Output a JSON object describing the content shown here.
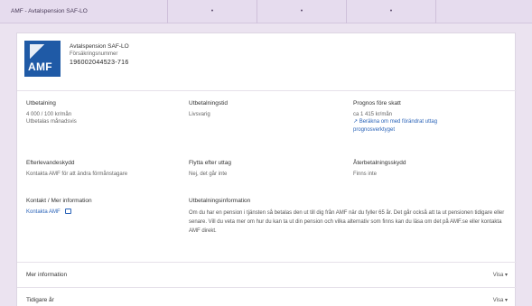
{
  "topbar": {
    "title": "AMF - Avtalspension SAF-LO",
    "tabs": [
      "•",
      "•",
      "•"
    ]
  },
  "company": {
    "logo_text": "AMF",
    "name": "Avtalspension SAF-LO",
    "type": "Försäkringsnummer",
    "orgnr": "196002044523-716"
  },
  "fields": {
    "utbetalning": {
      "label": "Utbetalning",
      "value1": "4 000 / 100 kr/mån",
      "value2": "Utbetalas månadsvis"
    },
    "utbetalningsform": {
      "label": "Utbetalningstid",
      "value": "Livsvarig"
    },
    "prognos": {
      "label": "Prognos före skatt",
      "value": "ca 1 415 kr/mån",
      "link1": "Beräkna om med förändrat uttag",
      "link2": "prognosverktyget"
    },
    "efterlevandeskydd": {
      "label": "Efterlevandeskydd",
      "value": "Kontakta AMF för att ändra förmånstagare"
    },
    "flytta": {
      "label": "Flytta efter uttag",
      "value": "Nej, det går inte"
    },
    "aterbetalning": {
      "label": "Återbetalningsskydd",
      "value": "Finns inte"
    },
    "kontakt": {
      "label": "Kontakt / Mer information",
      "link": "Kontakta AMF"
    },
    "utbetalningsinfo": {
      "label": "Utbetalningsinformation",
      "text": "Om du har en pension i tjänsten så betalas den ut till dig från AMF när du fyller 65 år. Det går också att ta ut pensionen tidigare eller senare. Vill du veta mer om hur du kan ta ut din pension och vilka alternativ som finns kan du läsa om det på AMF.se eller kontakta AMF direkt."
    }
  },
  "accordions": [
    {
      "title": "Mer information",
      "toggle": "Visa ▾"
    },
    {
      "title": "Tidigare år",
      "toggle": "Visa ▾"
    }
  ]
}
